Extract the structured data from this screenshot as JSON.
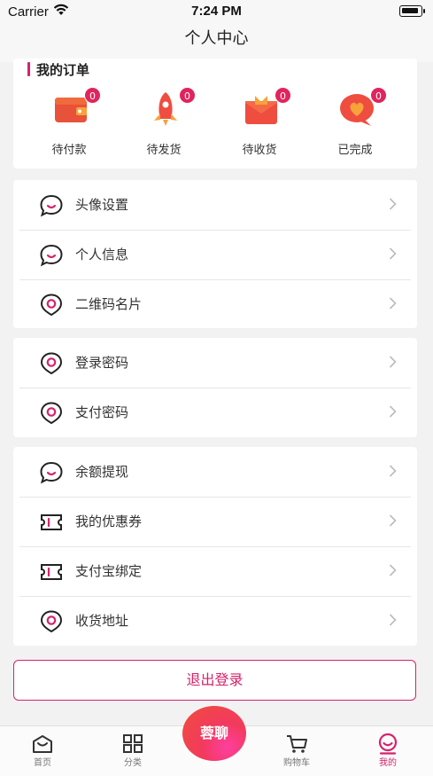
{
  "status_bar": {
    "carrier": "Carrier",
    "time": "7:24 PM"
  },
  "nav": {
    "title": "个人中心"
  },
  "orders": {
    "title": "我的订单",
    "items": [
      {
        "label": "待付款",
        "count": "0",
        "icon": "wallet-icon"
      },
      {
        "label": "待发货",
        "count": "0",
        "icon": "rocket-icon"
      },
      {
        "label": "待收货",
        "count": "0",
        "icon": "envelope-icon"
      },
      {
        "label": "已完成",
        "count": "0",
        "icon": "heart-bubble-icon"
      }
    ]
  },
  "group1": [
    {
      "label": "头像设置",
      "icon": "chat-bubble-icon"
    },
    {
      "label": "个人信息",
      "icon": "chat-bubble-icon"
    },
    {
      "label": "二维码名片",
      "icon": "location-pin-icon"
    }
  ],
  "group2": [
    {
      "label": "登录密码",
      "icon": "location-pin-icon"
    },
    {
      "label": "支付密码",
      "icon": "location-pin-icon"
    }
  ],
  "group3": [
    {
      "label": "余额提现",
      "icon": "chat-bubble-icon"
    },
    {
      "label": "我的优惠券",
      "icon": "ticket-icon"
    },
    {
      "label": "支付宝绑定",
      "icon": "ticket-icon"
    },
    {
      "label": "收货地址",
      "icon": "location-pin-icon"
    }
  ],
  "logout_label": "退出登录",
  "tabs": [
    {
      "label": "首页",
      "icon": "home-icon"
    },
    {
      "label": "分类",
      "icon": "grid-icon"
    },
    {
      "label": "蓉聊",
      "icon": "chat-fab"
    },
    {
      "label": "购物车",
      "icon": "cart-icon"
    },
    {
      "label": "我的",
      "icon": "profile-icon"
    }
  ],
  "colors": {
    "accent": "#d6226b",
    "badge": "#e0245e"
  }
}
